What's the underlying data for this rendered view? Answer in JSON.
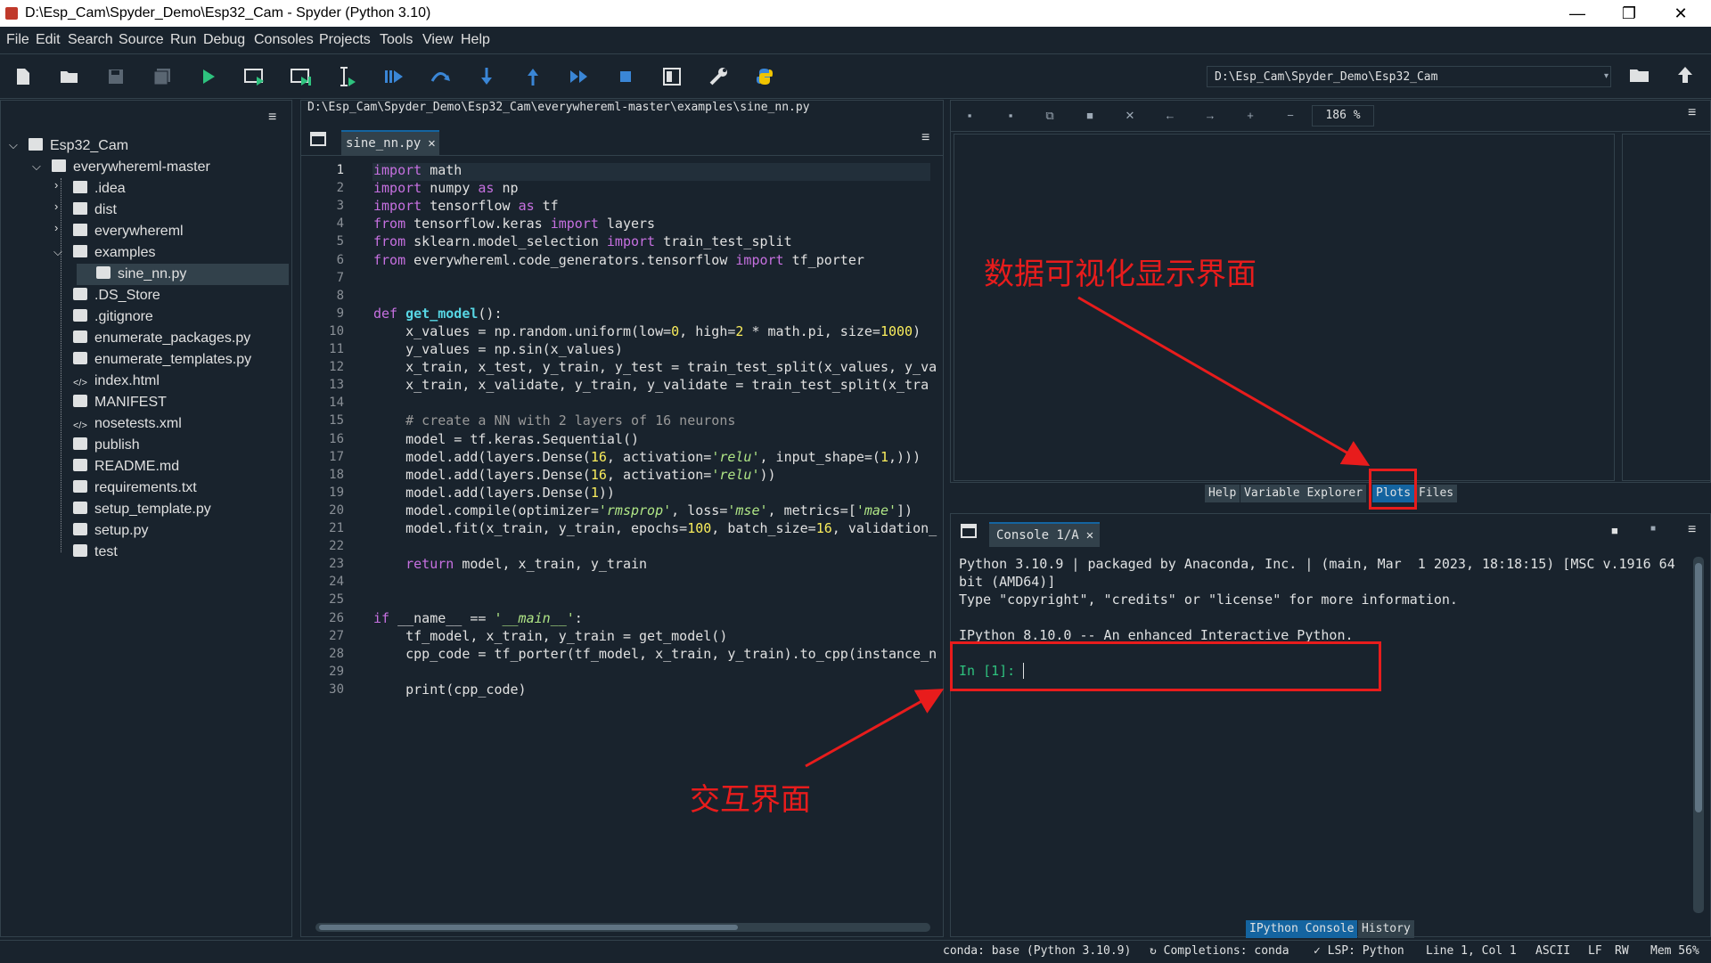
{
  "window": {
    "title": "D:\\Esp_Cam\\Spyder_Demo\\Esp32_Cam - Spyder (Python 3.10)",
    "controls": [
      "—",
      "❐",
      "✕"
    ]
  },
  "menu": [
    "File",
    "Edit",
    "Search",
    "Source",
    "Run",
    "Debug",
    "Consoles",
    "Projects",
    "Tools",
    "View",
    "Help"
  ],
  "toolbar": {
    "icons": [
      "new-file-icon",
      "open-folder-icon",
      "save-icon",
      "save-all-icon",
      "run-icon",
      "run-cell-icon",
      "run-cell-advance-icon",
      "run-selection-icon",
      "debug-icon",
      "step-icon",
      "step-into-icon",
      "step-return-icon",
      "continue-icon",
      "stop-icon",
      "maximize-pane-icon",
      "preferences-icon",
      "python-path-icon"
    ],
    "working_dir": "D:\\Esp_Cam\\Spyder_Demo\\Esp32_Cam"
  },
  "files": {
    "root": "Esp32_Cam",
    "items": [
      {
        "label": "everywhereml-master",
        "kind": "folder"
      },
      {
        "label": ".idea",
        "kind": "folder"
      },
      {
        "label": "dist",
        "kind": "folder"
      },
      {
        "label": "everywhereml",
        "kind": "folder"
      },
      {
        "label": "examples",
        "kind": "folder"
      },
      {
        "label": "sine_nn.py",
        "kind": "py"
      },
      {
        "label": ".DS_Store",
        "kind": "bin"
      },
      {
        "label": ".gitignore",
        "kind": "bin"
      },
      {
        "label": "enumerate_packages.py",
        "kind": "py"
      },
      {
        "label": "enumerate_templates.py",
        "kind": "py"
      },
      {
        "label": "index.html",
        "kind": "code"
      },
      {
        "label": "MANIFEST",
        "kind": "bin"
      },
      {
        "label": "nosetests.xml",
        "kind": "code"
      },
      {
        "label": "publish",
        "kind": "bin"
      },
      {
        "label": "README.md",
        "kind": "md"
      },
      {
        "label": "requirements.txt",
        "kind": "txt"
      },
      {
        "label": "setup_template.py",
        "kind": "py"
      },
      {
        "label": "setup.py",
        "kind": "py"
      },
      {
        "label": "test",
        "kind": "bin"
      }
    ]
  },
  "editor": {
    "path": "D:\\Esp_Cam\\Spyder_Demo\\Esp32_Cam\\everywhereml-master\\examples\\sine_nn.py",
    "tab": "sine_nn.py",
    "line_numbers": [
      "1",
      "2",
      "3",
      "4",
      "5",
      "6",
      "7",
      "8",
      "9",
      "10",
      "11",
      "12",
      "13",
      "14",
      "15",
      "16",
      "17",
      "18",
      "19",
      "20",
      "21",
      "22",
      "23",
      "24",
      "25",
      "26",
      "27",
      "28",
      "29",
      "30"
    ],
    "lines": [
      "import math",
      "import numpy as np",
      "import tensorflow as tf",
      "from tensorflow.keras import layers",
      "from sklearn.model_selection import train_test_split",
      "from everywhereml.code_generators.tensorflow import tf_porter",
      "",
      "",
      "def get_model():",
      "    x_values = np.random.uniform(low=0, high=2 * math.pi, size=1000)",
      "    y_values = np.sin(x_values)",
      "    x_train, x_test, y_train, y_test = train_test_split(x_values, y_va",
      "    x_train, x_validate, y_train, y_validate = train_test_split(x_tra",
      "",
      "    # create a NN with 2 layers of 16 neurons",
      "    model = tf.keras.Sequential()",
      "    model.add(layers.Dense(16, activation='relu', input_shape=(1,)))",
      "    model.add(layers.Dense(16, activation='relu'))",
      "    model.add(layers.Dense(1))",
      "    model.compile(optimizer='rmsprop', loss='mse', metrics=['mae'])",
      "    model.fit(x_train, y_train, epochs=100, batch_size=16, validation_",
      "",
      "    return model, x_train, y_train",
      "",
      "",
      "if __name__ == '__main__':",
      "    tf_model, x_train, y_train = get_model()",
      "    cpp_code = tf_porter(tf_model, x_train, y_train).to_cpp(instance_n",
      "",
      "    print(cpp_code)"
    ]
  },
  "plots": {
    "zoom": "186 %",
    "tabs": [
      "Help",
      "Variable Explorer",
      "Plots",
      "Files"
    ],
    "active_tab": "Plots"
  },
  "console": {
    "tab": "Console 1/A",
    "lines": [
      "Python 3.10.9 | packaged by Anaconda, Inc. | (main, Mar  1 2023, 18:18:15) [MSC v.1916 64",
      "bit (AMD64)]",
      "Type \"copyright\", \"credits\" or \"license\" for more information.",
      "",
      "IPython 8.10.0 -- An enhanced Interactive Python."
    ],
    "prompt": "In [1]: ",
    "bottom_tabs": [
      "IPython Console",
      "History"
    ]
  },
  "status": {
    "conda": "conda: base (Python 3.10.9)",
    "completions": "Completions: conda",
    "lsp": "LSP: Python",
    "position": "Line 1, Col 1",
    "encoding": "ASCII",
    "eol": "LF",
    "perm": "RW",
    "mem": "Mem 56%"
  },
  "annotations": {
    "plots_label": "数据可视化显示界面",
    "console_label": "交互界面",
    "color": "#e81c1c"
  }
}
